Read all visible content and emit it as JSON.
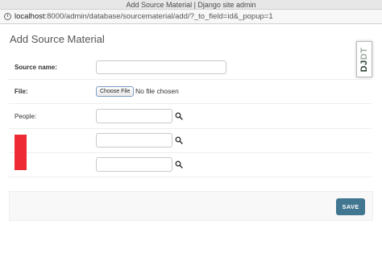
{
  "window": {
    "title": "Add Source Material | Django site admin"
  },
  "address_bar": {
    "host": "localhost",
    "path": ":8000/admin/database/sourcematerial/add/?_to_field=id&_popup=1"
  },
  "page": {
    "title": "Add Source Material"
  },
  "debug_toolbar": {
    "logo_main": "DJ",
    "logo_dim": "DT"
  },
  "form": {
    "source_name_label": "Source name:",
    "source_name_value": "",
    "file_label": "File:",
    "choose_file_label": "Choose File",
    "file_status": "No file chosen",
    "people_label": "People:",
    "people_values": [
      "",
      "",
      ""
    ]
  },
  "actions": {
    "save_label": "SAVE"
  },
  "colors": {
    "save_button": "#417690",
    "redaction": "#ee2a35"
  }
}
